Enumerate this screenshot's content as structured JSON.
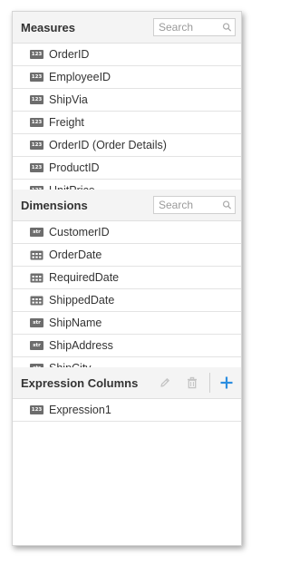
{
  "measures": {
    "title": "Measures",
    "search_placeholder": "Search",
    "items": [
      {
        "type": "123",
        "label": "OrderID"
      },
      {
        "type": "123",
        "label": "EmployeeID"
      },
      {
        "type": "123",
        "label": "ShipVia"
      },
      {
        "type": "123",
        "label": "Freight"
      },
      {
        "type": "123",
        "label": "OrderID (Order Details)"
      },
      {
        "type": "123",
        "label": "ProductID"
      },
      {
        "type": "123",
        "label": "UnitPrice"
      }
    ]
  },
  "dimensions": {
    "title": "Dimensions",
    "search_placeholder": "Search",
    "items": [
      {
        "type": "str",
        "label": "CustomerID"
      },
      {
        "type": "date",
        "label": "OrderDate"
      },
      {
        "type": "date",
        "label": "RequiredDate"
      },
      {
        "type": "date",
        "label": "ShippedDate"
      },
      {
        "type": "str",
        "label": "ShipName"
      },
      {
        "type": "str",
        "label": "ShipAddress"
      },
      {
        "type": "str",
        "label": "ShipCity"
      }
    ]
  },
  "expression_columns": {
    "title": "Expression Columns",
    "items": [
      {
        "type": "123",
        "label": "Expression1"
      }
    ]
  },
  "icons": {
    "edit": "pencil-icon",
    "delete": "trash-icon",
    "add": "plus-icon",
    "search": "search-icon",
    "date": "calendar-icon"
  },
  "colors": {
    "accent": "#2b8de0",
    "badge": "#6d6d6d",
    "disabled_icon": "#c4c4c4"
  }
}
